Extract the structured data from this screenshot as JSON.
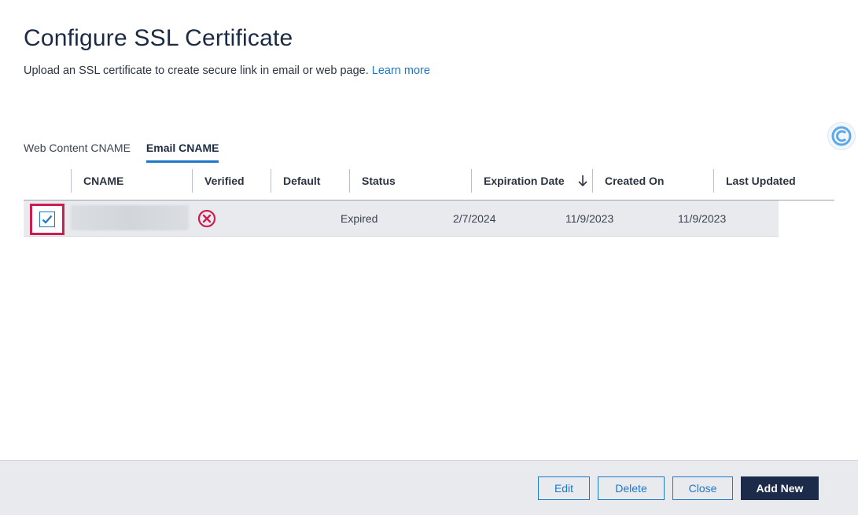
{
  "header": {
    "title": "Configure SSL Certificate",
    "subtitle": "Upload an SSL certificate to create secure link in email or web page.",
    "learn_more": "Learn more"
  },
  "tabs": [
    {
      "label": "Web Content CNAME",
      "active": false
    },
    {
      "label": "Email CNAME",
      "active": true
    }
  ],
  "table": {
    "columns": [
      "CNAME",
      "Verified",
      "Default",
      "Status",
      "Expiration Date",
      "Created On",
      "Last Updated"
    ],
    "sort_column": "Expiration Date",
    "sort_direction": "descending",
    "rows": [
      {
        "selected": true,
        "cname": "",
        "verified_icon": "error-circle-icon",
        "default": "",
        "status": "Expired",
        "expiration_date": "2/7/2024",
        "created_on": "11/9/2023",
        "last_updated": "11/9/2023"
      }
    ]
  },
  "footer": {
    "edit": "Edit",
    "delete": "Delete",
    "close": "Close",
    "add_new": "Add New"
  },
  "colors": {
    "accent": "#1e78c8",
    "primary_button": "#1c2b4a",
    "error": "#cc1f4f",
    "row_bg": "#e8eaee"
  }
}
